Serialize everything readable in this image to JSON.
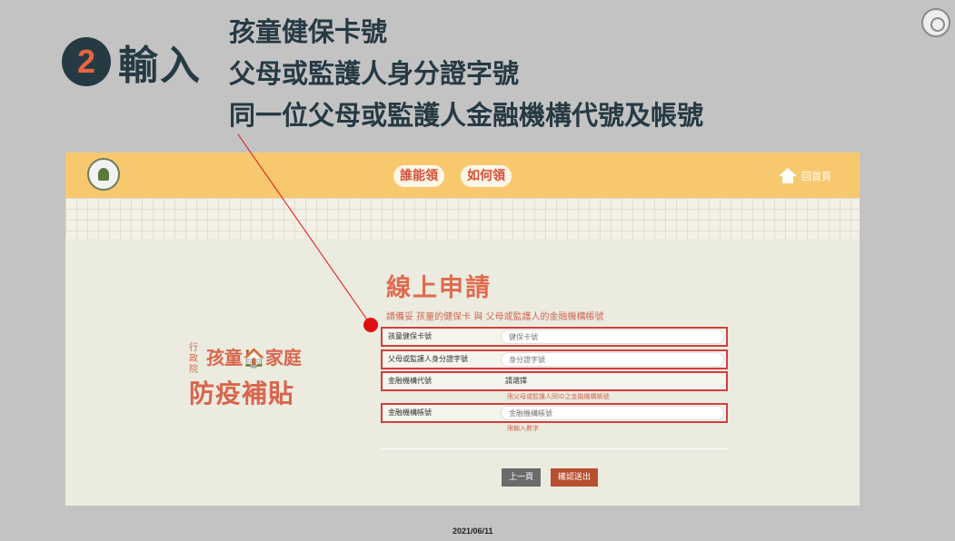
{
  "slide": {
    "step_number": "2",
    "step_word": "輸入",
    "step_items": [
      "孩童健保卡號",
      "父母或監護人身分證字號",
      "同一位父母或監護人金融機構代號及帳號"
    ],
    "date": "2021/06/11"
  },
  "site": {
    "nav": {
      "who": "誰能領",
      "how": "如何領"
    },
    "home_label": "回首頁",
    "brand": {
      "agency": "行政院",
      "line1": "孩童🏠家庭",
      "line2": "防疫補貼"
    }
  },
  "form": {
    "title": "線上申請",
    "hint": "請備妥 孩童的健保卡 與 父母或監護人的金融機構帳號",
    "fields": {
      "insurance": {
        "label": "孩童健保卡號",
        "placeholder": "健保卡號"
      },
      "parent_id": {
        "label": "父母或監護人身分證字號",
        "placeholder": "身分證字號"
      },
      "bank_code": {
        "label": "金融機構代號",
        "value": "請選擇",
        "note": "限父母或監護人同ID之金融機構帳號"
      },
      "account": {
        "label": "金融機構帳號",
        "placeholder": "金融機構帳號",
        "note": "限輸入數字"
      }
    },
    "buttons": {
      "prev": "上一頁",
      "submit": "確認送出"
    }
  },
  "colors": {
    "slide_bg": "#c3c3c3",
    "topbar": "#f8c86f",
    "accent": "#e06a4d",
    "highlight": "#d23e3e",
    "title_dark": "#263a44"
  }
}
